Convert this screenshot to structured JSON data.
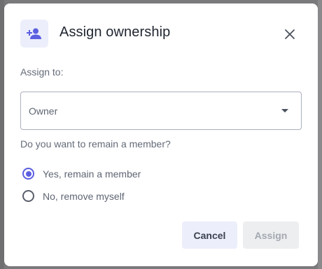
{
  "dialog": {
    "title": "Assign ownership",
    "header_icon": "person-add-icon",
    "close_icon": "close-icon",
    "accent_color": "#5b5fe0"
  },
  "assign": {
    "label": "Assign to:",
    "selected_value": "Owner",
    "caret_icon": "caret-down-icon"
  },
  "membership": {
    "question": "Do you want to remain a member?",
    "options": [
      {
        "label": "Yes, remain a member",
        "checked": true
      },
      {
        "label": "No, remove myself",
        "checked": false
      }
    ]
  },
  "actions": {
    "cancel_label": "Cancel",
    "assign_label": "Assign",
    "assign_disabled": true
  }
}
